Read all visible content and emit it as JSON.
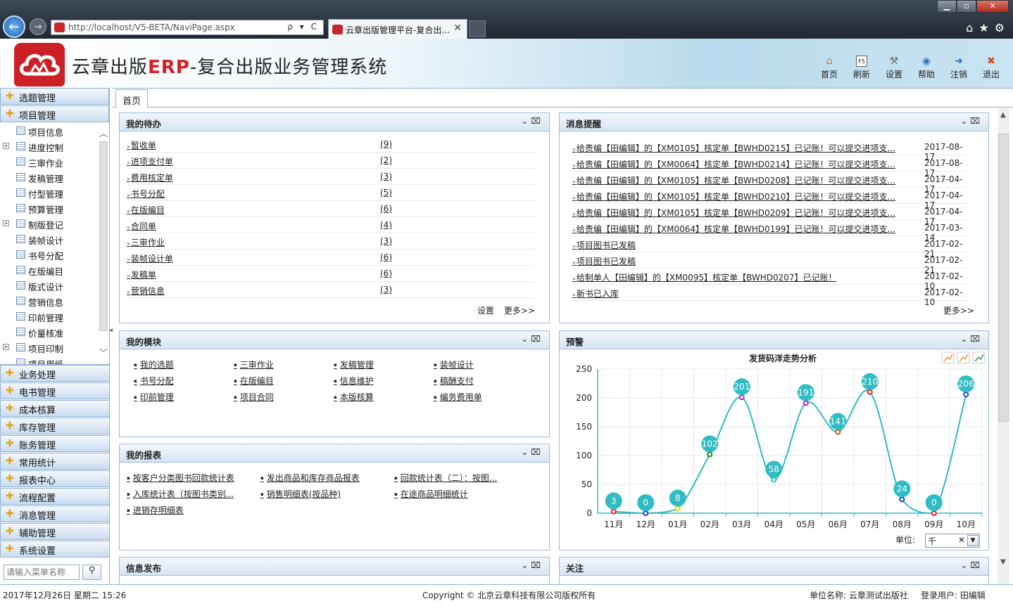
{
  "browser": {
    "url": "http://localhost/V5-BETA/NaviPage.aspx",
    "tab_title": "云章出版管理平台-复合出...",
    "url_tools": "ρ ▾ C"
  },
  "header": {
    "title_prefix": "云章出版",
    "title_erp": "ERP",
    "title_suffix": "-复合出版业务管理系统",
    "toolbar": [
      {
        "label": "首页",
        "icon": "home-icon"
      },
      {
        "label": "刷新",
        "icon": "refresh-icon",
        "glyph": "F5"
      },
      {
        "label": "设置",
        "icon": "settings-icon"
      },
      {
        "label": "帮助",
        "icon": "help-icon"
      },
      {
        "label": "注销",
        "icon": "logout-icon"
      },
      {
        "label": "退出",
        "icon": "exit-icon"
      }
    ]
  },
  "sidebar": {
    "groups_top": [
      "选题管理",
      "项目管理"
    ],
    "tree": [
      {
        "label": "项目信息",
        "expandable": false
      },
      {
        "label": "进度控制",
        "expandable": true
      },
      {
        "label": "三审作业",
        "expandable": false
      },
      {
        "label": "发稿管理",
        "expandable": false
      },
      {
        "label": "付型管理",
        "expandable": false
      },
      {
        "label": "预算管理",
        "expandable": false
      },
      {
        "label": "制版登记",
        "expandable": true
      },
      {
        "label": "装帧设计",
        "expandable": false
      },
      {
        "label": "书号分配",
        "expandable": false
      },
      {
        "label": "在版编目",
        "expandable": false
      },
      {
        "label": "版式设计",
        "expandable": false
      },
      {
        "label": "营销信息",
        "expandable": false
      },
      {
        "label": "印前管理",
        "expandable": false
      },
      {
        "label": "价量核准",
        "expandable": false
      },
      {
        "label": "项目印制",
        "expandable": true
      },
      {
        "label": "项目用纸",
        "expandable": false
      }
    ],
    "groups_bottom": [
      "业务处理",
      "电书管理",
      "成本核算",
      "库存管理",
      "账务管理",
      "常用统计",
      "报表中心",
      "流程配置",
      "消息管理",
      "辅助管理",
      "系统设置"
    ],
    "search_placeholder": "请输入菜单名称"
  },
  "main": {
    "home_tab": "首页",
    "todo": {
      "title": "我的待办",
      "items": [
        {
          "name": "暂收单",
          "count": "(9)"
        },
        {
          "name": "进项支付单",
          "count": "(2)"
        },
        {
          "name": "费用核定单",
          "count": "(3)"
        },
        {
          "name": "书号分配",
          "count": "(5)"
        },
        {
          "name": "在版编目",
          "count": "(6)"
        },
        {
          "name": "合同单",
          "count": "(4)"
        },
        {
          "name": "三审作业",
          "count": "(3)"
        },
        {
          "name": "装帧设计单",
          "count": "(6)"
        },
        {
          "name": "发稿单",
          "count": "(6)"
        },
        {
          "name": "营销信息",
          "count": "(3)"
        }
      ],
      "settings": "设置",
      "more": "更多>>"
    },
    "messages": {
      "title": "消息提醒",
      "items": [
        {
          "text": "给责编【田编辑】的【XM0105】核定单【BWHD0215】已记账！可以提交进项支...",
          "date": "2017-08-17"
        },
        {
          "text": "给责编【田编辑】的【XM0064】核定单【BWHD0214】已记账！可以提交进项支...",
          "date": "2017-08-17"
        },
        {
          "text": "给责编【田编辑】的【XM0105】核定单【BWHD0208】已记账！可以提交进项支...",
          "date": "2017-04-17"
        },
        {
          "text": "给责编【田编辑】的【XM0105】核定单【BWHD0210】已记账！可以提交进项支...",
          "date": "2017-04-17"
        },
        {
          "text": "给责编【田编辑】的【XM0105】核定单【BWHD0209】已记账！可以提交进项支...",
          "date": "2017-04-17"
        },
        {
          "text": "给责编【田编辑】的【XM0064】核定单【BWHD0199】已记账！可以提交进项支...",
          "date": "2017-03-14"
        },
        {
          "text": "项目图书已发稿",
          "date": "2017-02-21"
        },
        {
          "text": "项目图书已发稿",
          "date": "2017-02-21"
        },
        {
          "text": "给制单人【田编辑】的【XM0095】核定单【BWHD0207】已记账！",
          "date": "2017-02-10"
        },
        {
          "text": "新书已入库",
          "date": "2017-02-10"
        }
      ],
      "more": "更多>>"
    },
    "modules": {
      "title": "我的模块",
      "items": [
        "我的选题",
        "三审作业",
        "发稿管理",
        "装帧设计",
        "书号分配",
        "在版编目",
        "信息维护",
        "稿酬支付",
        "印前管理",
        "项目合同",
        "本版核算",
        "编务费用单"
      ]
    },
    "reports": {
      "title": "我的报表",
      "items": [
        "按客户分类图书回款统计表",
        "发出商品和库存商品报表",
        "回款统计表（二）：按图...",
        "入库统计表（按图书类别...",
        "销售明细表(按品种)",
        "在途商品明细统计",
        "进销存明细表"
      ]
    },
    "warning": {
      "title": "预警",
      "unit_label": "单位:",
      "unit_value": "千"
    },
    "info": {
      "title": "信息发布"
    },
    "follow": {
      "title": "关注"
    }
  },
  "chart_data": {
    "type": "line",
    "title": "发货码洋走势分析",
    "categories": [
      "11月",
      "12月",
      "01月",
      "02月",
      "03月",
      "04月",
      "05月",
      "06月",
      "07月",
      "08月",
      "09月",
      "10月"
    ],
    "values": [
      3,
      0,
      8,
      102,
      201,
      58,
      191,
      141,
      210,
      24,
      0,
      206
    ],
    "ylim": [
      0,
      250
    ],
    "yticks": [
      0,
      50,
      100,
      150,
      200,
      250
    ],
    "grid": true,
    "line_color": "#2fbcc4",
    "point_colors": [
      "#e02020",
      "#1a3fd1",
      "#e8d800",
      "#1a8a1a",
      "#c020c0",
      "#2fbcc4",
      "#c020c0",
      "#b85a10",
      "#e02020",
      "#1a3fd1",
      "#e02020",
      "#1a3fd1"
    ]
  },
  "status": {
    "datetime": "2017年12月26日 星期二 15:26",
    "copyright": "Copyright © 北京云章科技有限公司版权所有",
    "unit": "单位名称: 云章测试出版社",
    "user": "登录用户: 田编辑"
  }
}
